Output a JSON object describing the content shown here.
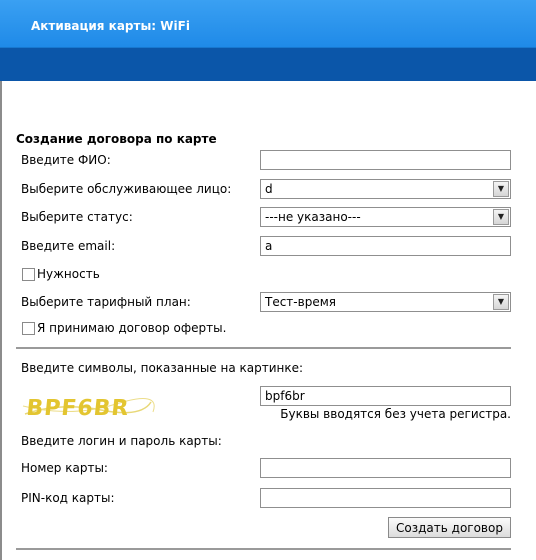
{
  "header": {
    "title": "Активация карты: WiFi"
  },
  "form": {
    "section_title": "Создание договора по карте",
    "fio": {
      "label": "Введите ФИО:",
      "value": ""
    },
    "service_person": {
      "label": "Выберите обслуживающее лицо:",
      "selected": "d"
    },
    "status": {
      "label": "Выберите статус:",
      "selected": "---не указано---"
    },
    "email": {
      "label": "Введите email:",
      "value": "а"
    },
    "need": {
      "label": "Нужность",
      "checked": false
    },
    "tariff": {
      "label": "Выберите тарифный план:",
      "selected": "Тест-время"
    },
    "offer": {
      "label": "Я принимаю договор оферты.",
      "checked": false
    },
    "captcha": {
      "label": "Введите символы, показанные на картинке:",
      "image_text": "BPF6BR",
      "value": "bpf6br",
      "hint": "Буквы вводятся без учета регистра."
    },
    "card_prompt": "Введите логин и пароль карты:",
    "card_number": {
      "label": "Номер карты:",
      "value": ""
    },
    "pin": {
      "label": "PIN-код карты:",
      "value": ""
    },
    "submit_label": "Создать договор"
  }
}
